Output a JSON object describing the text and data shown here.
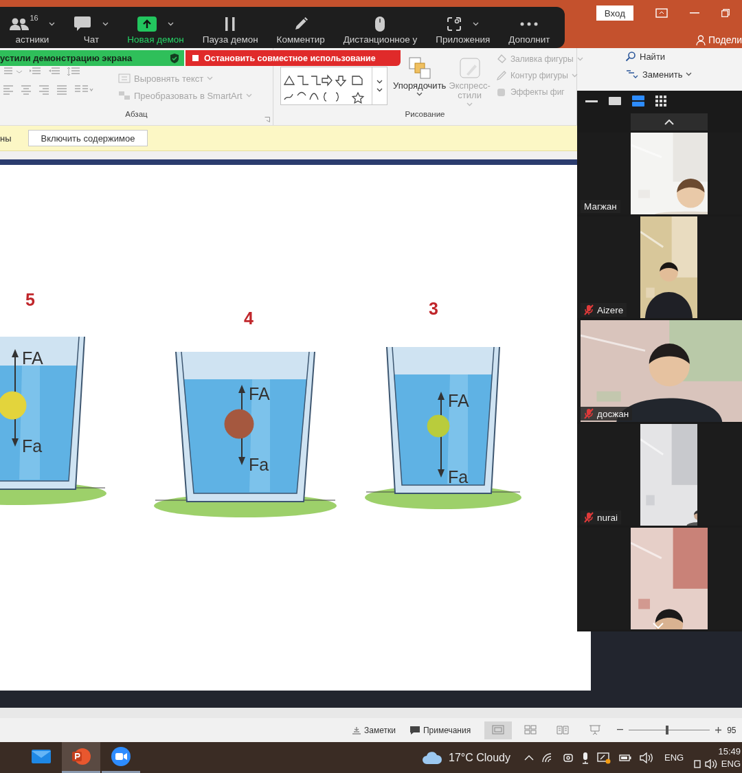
{
  "title_bar": {
    "sign_in_button": "Вход",
    "share_button": "Подели"
  },
  "meeting_toolbar": {
    "items": [
      {
        "label": "астники",
        "count": "16",
        "caret": true,
        "active": false
      },
      {
        "label": "Чат",
        "caret": true,
        "active": false
      },
      {
        "label": "Новая демон",
        "caret": true,
        "active": true
      },
      {
        "label": "Пауза демон",
        "caret": false,
        "active": false
      },
      {
        "label": "Комментир",
        "caret": false,
        "active": false
      },
      {
        "label": "Дистанционное у",
        "caret": false,
        "active": false
      },
      {
        "label": "Приложения",
        "caret": true,
        "active": false
      },
      {
        "label": "Дополнит",
        "caret": false,
        "active": false
      }
    ]
  },
  "share_banner": {
    "status": "устили демонстрацию экрана",
    "stop_button": "Остановить совместное использование"
  },
  "ribbon": {
    "paragraph_group": {
      "label": "Абзац",
      "commands": [
        {
          "label": "Выровнять текст",
          "disabled": true
        },
        {
          "label": "Преобразовать в SmartArt",
          "disabled": true
        }
      ]
    },
    "drawing_group": {
      "label": "Рисование",
      "arrange_button": {
        "label": "Упорядочить",
        "disabled": false
      },
      "quick_styles_button": {
        "label": "Экспресс-стили",
        "disabled": true
      },
      "shape_commands": [
        {
          "label": "Заливка фигуры",
          "disabled": true
        },
        {
          "label": "Контур фигуры",
          "disabled": true
        },
        {
          "label": "Эффекты фиг",
          "disabled": true
        }
      ]
    },
    "editing_group": [
      {
        "label": "Найти",
        "disabled": false
      },
      {
        "label": "Заменить",
        "disabled": false
      }
    ]
  },
  "message_bar": {
    "text": "ны",
    "button": "Включить содержимое"
  },
  "slide": {
    "glasses": [
      {
        "number": "5",
        "color": "#e3d43c",
        "up_force": "FA",
        "down_force": "Fa"
      },
      {
        "number": "4",
        "color": "#a5583f",
        "up_force": "FA",
        "down_force": "Fa"
      },
      {
        "number": "3",
        "color": "#b9cc3c",
        "up_force": "FA",
        "down_force": "Fa"
      }
    ]
  },
  "participants_panel": {
    "view_modes": [
      {
        "kind": "minimize",
        "selected": false
      },
      {
        "kind": "thumbnail",
        "selected": false
      },
      {
        "kind": "strip",
        "selected": true
      },
      {
        "kind": "gallery",
        "selected": false
      }
    ],
    "participants": [
      {
        "name": "Магжан",
        "muted": false
      },
      {
        "name": "Aizere",
        "muted": true
      },
      {
        "name": "досжан",
        "muted": true
      },
      {
        "name": "nurai",
        "muted": true
      },
      {
        "kind": "picture"
      }
    ]
  },
  "status_bar": {
    "notes_button": "Заметки",
    "comments_button": "Примечания",
    "views": [
      {
        "kind": "normal",
        "selected": true
      },
      {
        "kind": "sorter",
        "selected": false
      },
      {
        "kind": "reading",
        "selected": false
      },
      {
        "kind": "slideshow",
        "selected": false
      }
    ],
    "zoom": {
      "level": 0.47,
      "percent": "95"
    }
  },
  "taskbar": {
    "apps": [
      {
        "kind": "mail",
        "selected": false,
        "running": false
      },
      {
        "kind": "powerpoint",
        "selected": true,
        "running": true
      },
      {
        "kind": "zoom",
        "selected": false,
        "running": true
      }
    ],
    "weather": "17°C Cloudy",
    "language": "ENG",
    "time": "15:49",
    "language_secondary": "ENG"
  }
}
